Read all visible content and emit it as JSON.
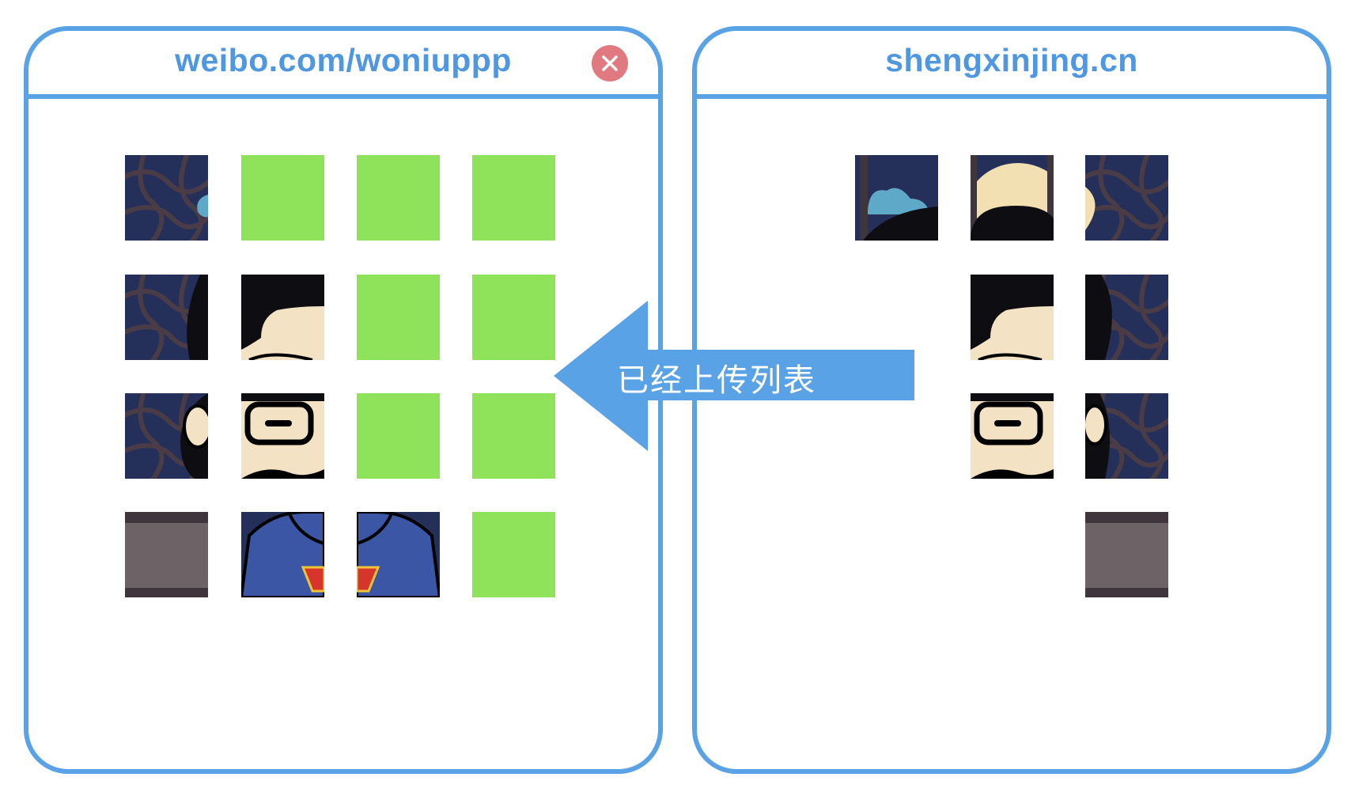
{
  "left_window": {
    "title": "weibo.com/woniuppp",
    "close_icon": "close-icon"
  },
  "right_window": {
    "title": "shengxinjing.cn"
  },
  "arrow": {
    "label": "已经上传列表",
    "color": "#5aa2e6"
  },
  "colors": {
    "border": "#5aa2e6",
    "title": "#4f97e0",
    "placeholder": "#8ee35a",
    "close": "#e07a80"
  },
  "left_grid": [
    [
      "bg-lattice-moon-edge",
      "placeholder",
      "placeholder",
      "placeholder"
    ],
    [
      "bg-lattice-hair-edge",
      "hair-forehead",
      "placeholder",
      "placeholder"
    ],
    [
      "bg-ear",
      "glasses-face",
      "placeholder",
      "placeholder"
    ],
    [
      "desk",
      "hoodie-left",
      "hoodie-right",
      "placeholder"
    ]
  ],
  "right_grid": [
    [
      "empty",
      "cloud-head",
      "moon-head",
      "lattice-moon"
    ],
    [
      "empty",
      "empty",
      "hair-forehead",
      "hair-lattice"
    ],
    [
      "empty",
      "empty",
      "glasses-face",
      "ear-lattice"
    ],
    [
      "empty",
      "empty",
      "empty",
      "desk"
    ]
  ]
}
